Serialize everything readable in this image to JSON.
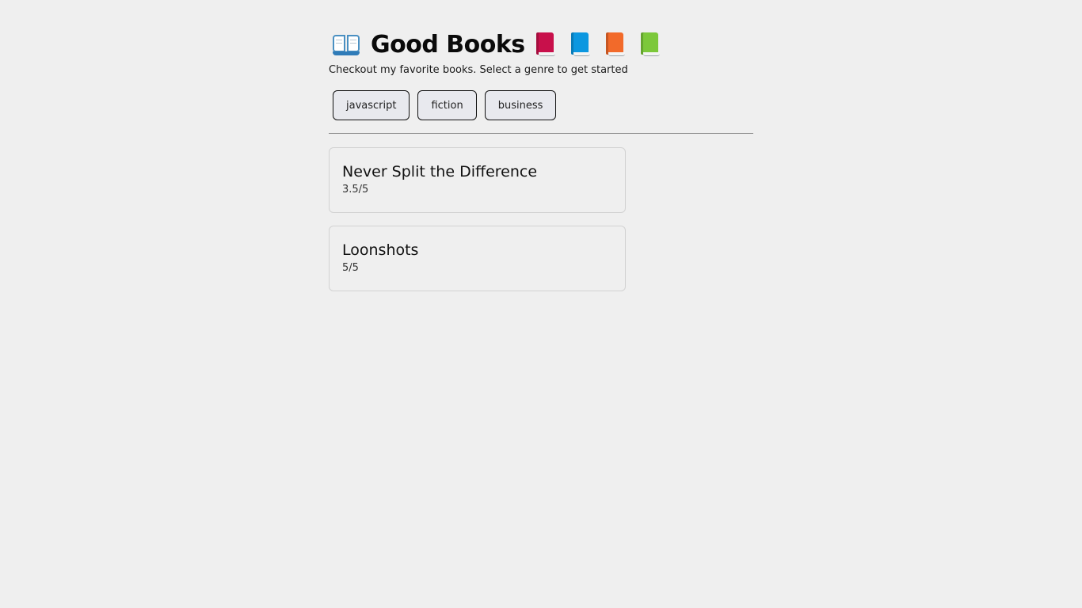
{
  "header": {
    "title": "Good Books",
    "subtitle": "Checkout my favorite books. Select a genre to get started",
    "icons": [
      "open-book",
      "closed-book-red",
      "closed-book-blue",
      "closed-book-orange",
      "closed-book-green"
    ],
    "colors": {
      "red_book": "#c8104b",
      "blue_book": "#0b97e0",
      "orange_book": "#f26a2a",
      "green_book": "#7cc83a"
    }
  },
  "genres": [
    {
      "label": "javascript"
    },
    {
      "label": "fiction"
    },
    {
      "label": "business"
    }
  ],
  "books": [
    {
      "name": "Never Split the Difference",
      "rating": "3.5/5"
    },
    {
      "name": "Loonshots",
      "rating": "5/5"
    }
  ]
}
